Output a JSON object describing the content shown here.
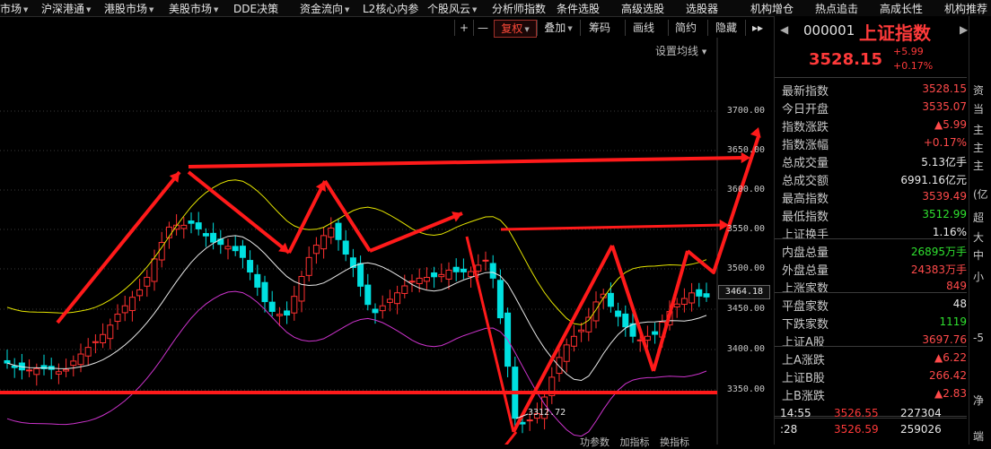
{
  "menu": [
    {
      "label": "市场",
      "dropdown": true
    },
    {
      "label": "沪深港通",
      "dropdown": true
    },
    {
      "label": "港股市场",
      "dropdown": true
    },
    {
      "label": "美股市场",
      "dropdown": true
    },
    {
      "label": "DDE决策",
      "dropdown": false
    },
    {
      "label": "资金流向",
      "dropdown": true
    },
    {
      "label": "L2核心内参",
      "dropdown": false
    },
    {
      "label": "个股风云",
      "dropdown": true
    },
    {
      "label": "分析师指数",
      "dropdown": false
    },
    {
      "label": "条件选股",
      "dropdown": false
    },
    {
      "label": "高级选股",
      "dropdown": false
    },
    {
      "label": "选股器",
      "dropdown": false
    },
    {
      "label": "机构增仓",
      "dropdown": false
    },
    {
      "label": "热点追击",
      "dropdown": false
    },
    {
      "label": "高成长性",
      "dropdown": false
    },
    {
      "label": "机构推荐",
      "dropdown": false
    }
  ],
  "toolbar": {
    "plus": "+",
    "minus": "—",
    "fuquan": "复权",
    "diejia": "叠加",
    "choumа": "筹码",
    "huaxian": "画线",
    "jianyue": "简约",
    "yincang": "隐藏",
    "more": "▸▸",
    "settings": "设置均线"
  },
  "chart": {
    "y_ticks": [
      "3700.00",
      "3650.00",
      "3600.00",
      "3550.00",
      "3500.00",
      "3450.00",
      "3400.00",
      "3350.00"
    ],
    "current_price_tag": "3464.18",
    "low_annotation": "3312.72",
    "bottom_tabs": [
      "功参数",
      "加指标",
      "换指标"
    ]
  },
  "quote": {
    "code": "000001",
    "name": "上证指数",
    "price": "3528.15",
    "change": "+5.99",
    "change_pct": "+0.17%",
    "rows": [
      {
        "label": "最新指数",
        "value": "3528.15",
        "color": "red"
      },
      {
        "label": "今日开盘",
        "value": "3535.07",
        "color": "red"
      },
      {
        "label": "指数涨跌",
        "value": "▲5.99",
        "color": "red"
      },
      {
        "label": "指数涨幅",
        "value": "+0.17%",
        "color": "red"
      },
      {
        "label": "总成交量",
        "value": "5.13亿手",
        "color": "white"
      },
      {
        "label": "总成交额",
        "value": "6991.16亿元",
        "color": "white"
      },
      {
        "label": "最高指数",
        "value": "3539.49",
        "color": "red"
      },
      {
        "label": "最低指数",
        "value": "3512.99",
        "color": "green"
      },
      {
        "label": "上证换手",
        "value": "1.16%",
        "color": "white"
      },
      {
        "label": "内盘总量",
        "value": "26895万手",
        "color": "green"
      },
      {
        "label": "外盘总量",
        "value": "24383万手",
        "color": "red"
      },
      {
        "label": "上涨家数",
        "value": "849",
        "color": "red"
      },
      {
        "label": "平盘家数",
        "value": "48",
        "color": "white"
      },
      {
        "label": "下跌家数",
        "value": "1119",
        "color": "green"
      },
      {
        "label": "上证A股",
        "value": "3697.76",
        "color": "red"
      },
      {
        "label": "上A涨跌",
        "value": "▲6.22",
        "color": "red"
      },
      {
        "label": "上证B股",
        "value": "266.42",
        "color": "red"
      },
      {
        "label": "上B涨跌",
        "value": "▲2.83",
        "color": "red"
      }
    ],
    "ticks": [
      {
        "time": "14:55",
        "price": "3526.55",
        "vol": "227304"
      },
      {
        "time": ":28",
        "price": "3526.59",
        "vol": "259026"
      }
    ],
    "side": [
      "资",
      "当",
      "主",
      "主",
      "主",
      "(亿",
      "超",
      "大",
      "中",
      "小",
      "-5",
      "净",
      "端"
    ]
  },
  "colors": {
    "up": "#ff3030",
    "down": "#00e0e0",
    "arrow": "#ff1a1a",
    "ma_white": "#e8e8e8",
    "boll_upper": "#e6e600",
    "boll_lower": "#cc33cc"
  }
}
